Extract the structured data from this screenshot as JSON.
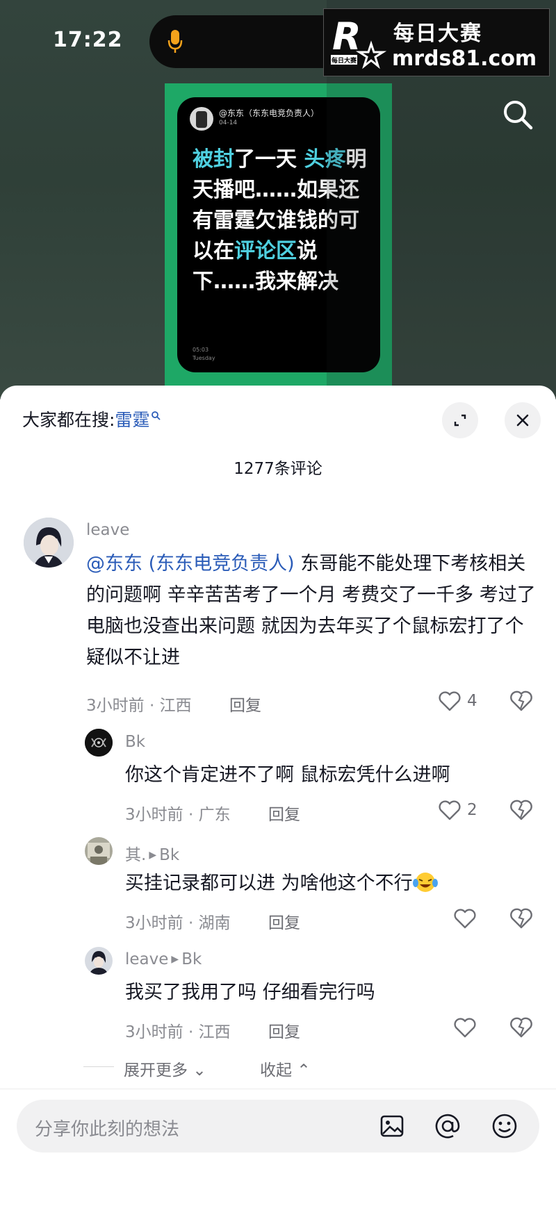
{
  "status": {
    "time": "17:22"
  },
  "watermark": {
    "logo_letter": "R",
    "logo_sub": "每日大赛",
    "title": "每日大赛",
    "url": "mrds81.com"
  },
  "post": {
    "author": "@东东（东东电竞负责人）",
    "date": "04-14",
    "text_parts": [
      "被封",
      "了一天 ",
      "头疼",
      "明天播吧……如果还有雷霆欠谁钱的可以在",
      "评论",
      "区",
      "说下……我来解决"
    ],
    "footer_time": "05:03",
    "footer_day": "Tuesday"
  },
  "sheet": {
    "search_prefix": "大家都在搜:",
    "search_keyword": "雷霆",
    "comment_count": "1277条评论",
    "expand_more": "展开更多",
    "collapse": "收起",
    "input_placeholder": "分享你此刻的想法"
  },
  "comments": [
    {
      "user": "leave",
      "mention": "@东东 (东东电竞负责人)",
      "text": " 东哥能不能处理下考核相关的问题啊 辛辛苦苦考了一个月 考费交了一千多 考过了电脑也没查出来问题 就因为去年买了个鼠标宏打了个疑似不让进",
      "time": "3小时前 · 江西",
      "reply": "回复",
      "likes": "4"
    },
    {
      "user": "Bk",
      "text": "你这个肯定进不了啊 鼠标宏凭什么进啊",
      "time": "3小时前 · 广东",
      "reply": "回复",
      "likes": "2"
    },
    {
      "user": "其.",
      "reply_to": "Bk",
      "text": "买挂记录都可以进 为啥他这个不行",
      "time": "3小时前 · 湖南",
      "reply": "回复",
      "likes": ""
    },
    {
      "user": "leave",
      "reply_to": "Bk",
      "text": "我买了我用了吗 仔细看完行吗",
      "time": "3小时前 · 江西",
      "reply": "回复",
      "likes": ""
    }
  ],
  "colors": {
    "accent_blue": "#2b5cb8",
    "card_green": "#1ea866",
    "highlight_cyan": "#4fd0e0"
  },
  "icons": [
    "mic-icon",
    "search-icon",
    "expand-icon",
    "close-icon",
    "heart-icon",
    "dislike-icon",
    "image-icon",
    "at-icon",
    "emoji-icon",
    "chevron-down-icon",
    "chevron-up-icon"
  ]
}
